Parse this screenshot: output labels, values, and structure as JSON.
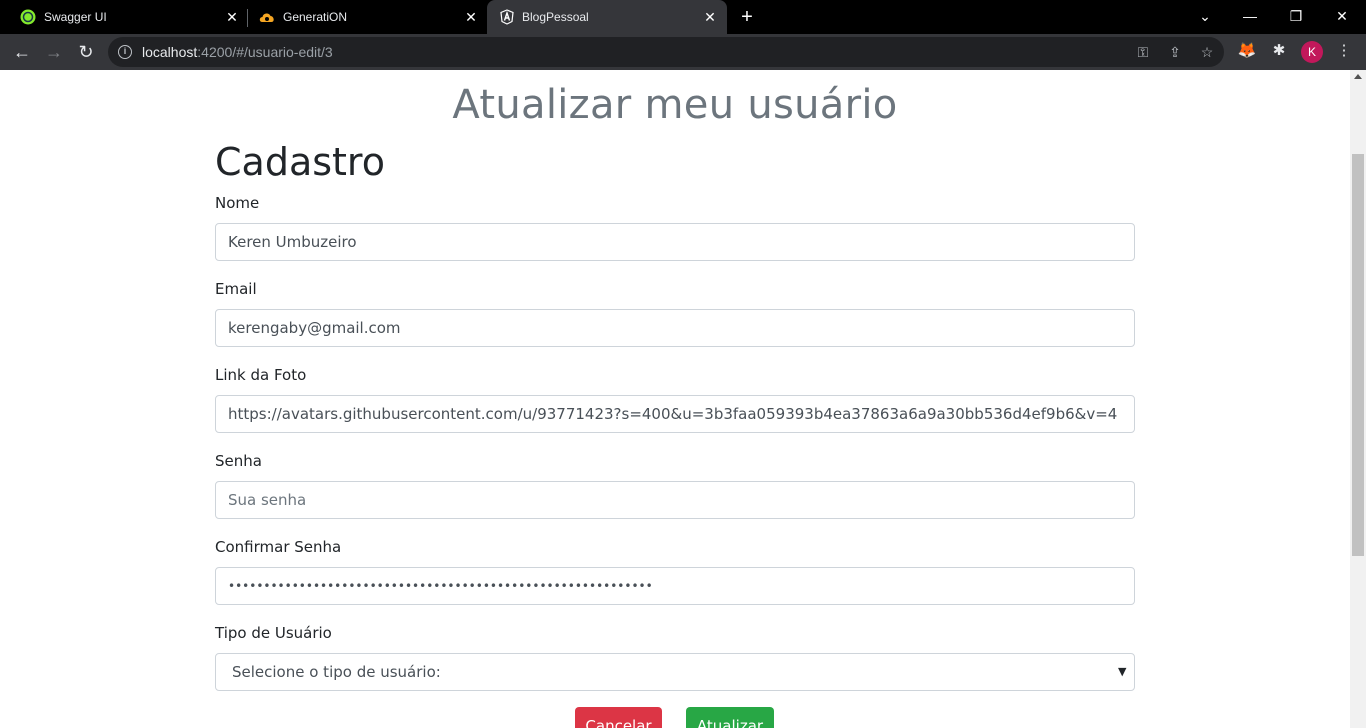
{
  "browser": {
    "tabs": [
      {
        "title": "Swagger UI",
        "icon": "swagger-icon"
      },
      {
        "title": "GeneratiON",
        "icon": "cloud-icon"
      },
      {
        "title": "BlogPessoal",
        "icon": "angular-icon"
      }
    ],
    "url_host": "localhost",
    "url_rest": ":4200/#/usuario-edit/3",
    "profile_initial": "K"
  },
  "page": {
    "heading": "Atualizar meu usuário",
    "form_title": "Cadastro"
  },
  "form": {
    "nome": {
      "label": "Nome",
      "value": "Keren Umbuzeiro"
    },
    "email": {
      "label": "Email",
      "value": "kerengaby@gmail.com"
    },
    "foto": {
      "label": "Link da Foto",
      "value": "https://avatars.githubusercontent.com/u/93771423?s=400&u=3b3faa059393b4ea37863a6a9a30bb536d4ef9b6&v=4"
    },
    "senha": {
      "label": "Senha",
      "placeholder": "Sua senha"
    },
    "confirmar": {
      "label": "Confirmar Senha",
      "masked_value": "••••••••••••••••••••••••••••••••••••••••••••••••••••••••••••"
    },
    "tipo": {
      "label": "Tipo de Usuário",
      "selected": "Selecione o tipo de usuário:"
    }
  },
  "actions": {
    "cancel": "Cancelar",
    "update": "Atualizar"
  },
  "colors": {
    "cancel": "#dc3545",
    "update": "#28a745",
    "heading": "#6c757d"
  }
}
